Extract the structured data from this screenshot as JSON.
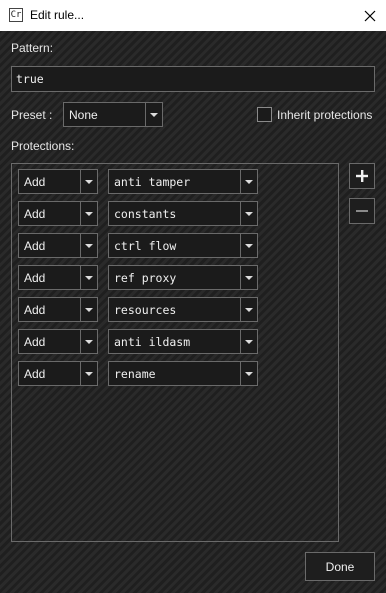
{
  "window": {
    "icon_text": "Cr",
    "title": "Edit rule..."
  },
  "pattern": {
    "label": "Pattern:",
    "value": "true"
  },
  "preset": {
    "label": "Preset :",
    "selected": "None"
  },
  "inherit": {
    "label": "Inherit protections",
    "checked": false
  },
  "protections": {
    "label": "Protections:",
    "rows": [
      {
        "action": "Add",
        "name": "anti tamper"
      },
      {
        "action": "Add",
        "name": "constants"
      },
      {
        "action": "Add",
        "name": "ctrl flow"
      },
      {
        "action": "Add",
        "name": "ref proxy"
      },
      {
        "action": "Add",
        "name": "resources"
      },
      {
        "action": "Add",
        "name": "anti ildasm"
      },
      {
        "action": "Add",
        "name": "rename"
      }
    ]
  },
  "buttons": {
    "done": "Done",
    "add_icon": "plus-icon",
    "remove_icon": "minus-icon"
  }
}
